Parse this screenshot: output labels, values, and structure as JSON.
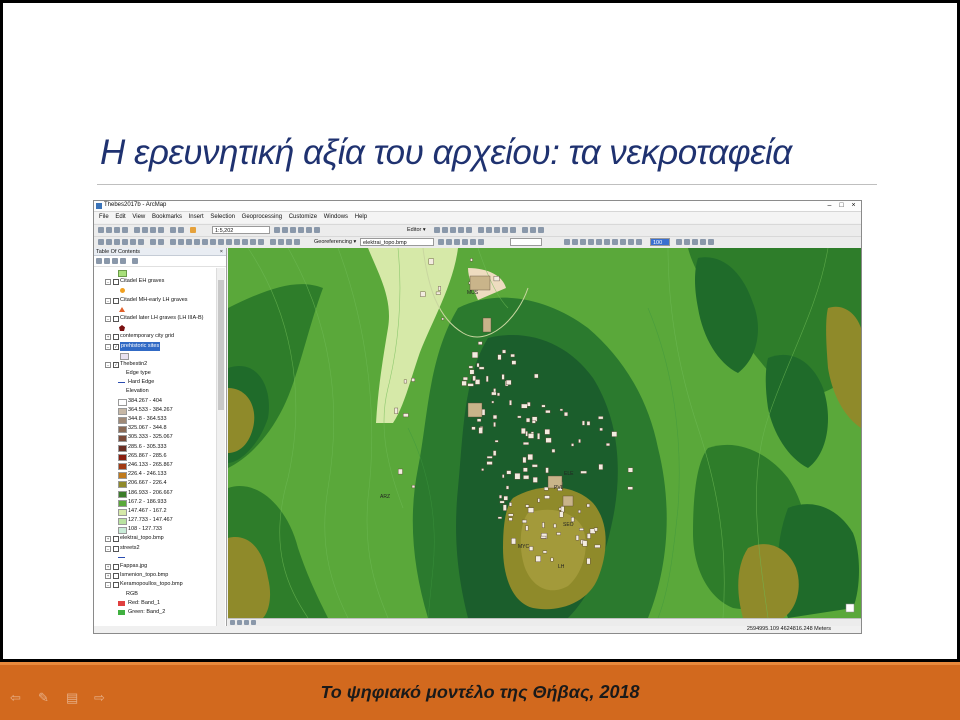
{
  "slide": {
    "title": "Η ερευνητική αξία του αρχείου: τα νεκροταφεία",
    "footer": "Το ψηφιακό μοντέλο της Θήβας, 2018",
    "colors": {
      "title": "#1f3270",
      "footer_bar": "#d2691e"
    }
  },
  "window": {
    "title": "Thebes2017b - ArcMap",
    "menu": [
      "File",
      "Edit",
      "View",
      "Bookmarks",
      "Insert",
      "Selection",
      "Geoprocessing",
      "Customize",
      "Windows",
      "Help"
    ],
    "scale": "1:5,202",
    "editor_label": "Editor ▾",
    "georeferencing_label": "Georeferencing ▾",
    "georef_layer": "elektrai_topo.bmp",
    "zoom_value": "100"
  },
  "toc": {
    "title": "Table Of Contents",
    "items": [
      {
        "label": "Citadel EH graves",
        "checked": false
      },
      {
        "label": "Citadel MH-early LH graves",
        "checked": false
      },
      {
        "label": "Citadel later LH graves (LH IIIA-B)",
        "checked": false
      },
      {
        "label": "contemporary city grid",
        "checked": false
      },
      {
        "label": "prehistoric sites",
        "checked": true,
        "selected": true
      },
      {
        "label": "Thebestin2",
        "checked": true
      },
      {
        "label": "Edge type"
      },
      {
        "label": "Hard Edge"
      },
      {
        "label": "Elevation"
      },
      {
        "label": "elektrai_topo.bmp",
        "checked": false
      },
      {
        "label": "streets2",
        "checked": false
      },
      {
        "label": "Fappas.jpg",
        "checked": false
      },
      {
        "label": "Ismenion_topo.bmp",
        "checked": false
      },
      {
        "label": "Keramopoullos_topo.bmp",
        "checked": false
      },
      {
        "label": "RGB"
      },
      {
        "label": "Red:   Band_1"
      },
      {
        "label": "Green: Band_2"
      }
    ],
    "elevation_classes": [
      {
        "range": "384.267 - 404",
        "color": "#ffffff"
      },
      {
        "range": "364.533 - 384.267",
        "color": "#c7b8a6"
      },
      {
        "range": "344.8 - 364.533",
        "color": "#a08a77"
      },
      {
        "range": "325.067 - 344.8",
        "color": "#8a6a55"
      },
      {
        "range": "305.333 - 325.067",
        "color": "#7a4a38"
      },
      {
        "range": "285.6 - 305.333",
        "color": "#6b2f24"
      },
      {
        "range": "265.867 - 285.6",
        "color": "#8a1f10"
      },
      {
        "range": "246.133 - 265.867",
        "color": "#a23a12"
      },
      {
        "range": "226.4 - 246.133",
        "color": "#c07a1c"
      },
      {
        "range": "206.667 - 226.4",
        "color": "#8f8a2a"
      },
      {
        "range": "186.933 - 206.667",
        "color": "#3c7d2a"
      },
      {
        "range": "167.2 - 186.933",
        "color": "#5aa83a"
      },
      {
        "range": "147.467 - 167.2",
        "color": "#d6e9a8"
      },
      {
        "range": "127.733 - 147.467",
        "color": "#b9e3a0"
      },
      {
        "range": "108 - 127.733",
        "color": "#c9ecd8"
      }
    ]
  },
  "map": {
    "labels": [
      "MUS",
      "ARZ",
      "PVL",
      "ELE",
      "LH",
      "SEO",
      "MYC"
    ]
  },
  "status": {
    "coordinates": "2594995.109  4624816.248 Meters"
  }
}
